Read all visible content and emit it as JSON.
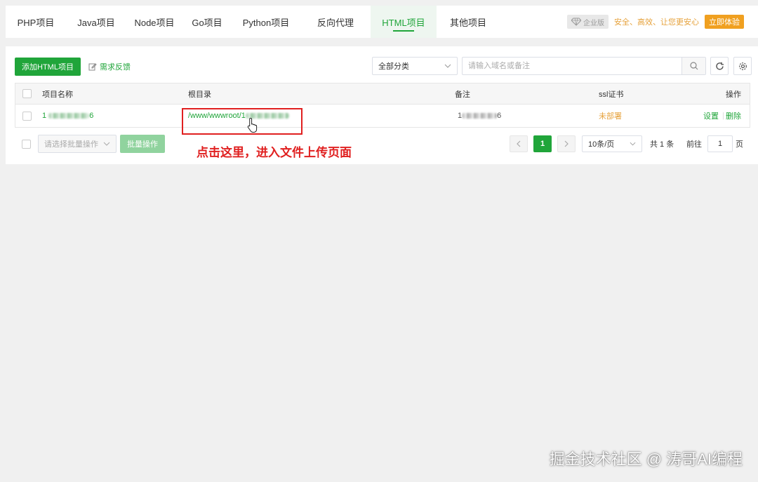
{
  "tabs": [
    {
      "label": "PHP项目"
    },
    {
      "label": "Java项目"
    },
    {
      "label": "Node项目"
    },
    {
      "label": "Go项目"
    },
    {
      "label": "Python项目"
    },
    {
      "label": "反向代理"
    },
    {
      "label": "HTML项目"
    },
    {
      "label": "其他项目"
    }
  ],
  "active_tab": "HTML项目",
  "enterprise": {
    "badge": "企业版",
    "slogan": "安全、高效、让您更安心",
    "trial_button": "立即体验"
  },
  "toolbar": {
    "add_button": "添加HTML项目",
    "feedback_link": "需求反馈",
    "category_select": "全部分类",
    "search_placeholder": "请输入域名或备注"
  },
  "table": {
    "columns": {
      "name": "项目名称",
      "root": "根目录",
      "remark": "备注",
      "ssl": "ssl证书",
      "ops": "操作"
    },
    "rows": [
      {
        "name_prefix": "1",
        "name_suffix": "6",
        "root_prefix": "/www/wwwroot/1",
        "remark_prefix": "1",
        "remark_suffix": "6",
        "ssl": "未部署",
        "action_settings": "设置",
        "action_delete": "删除"
      }
    ]
  },
  "annotation": "点击这里，进入文件上传页面",
  "footer": {
    "batch_select_placeholder": "请选择批量操作",
    "batch_button": "批量操作",
    "current_page": "1",
    "page_size": "10条/页",
    "total": "共 1 条",
    "goto_label": "前往",
    "goto_value": "1",
    "page_unit": "页"
  },
  "watermark": "掘金技术社区 @ 涛哥AI编程",
  "colors": {
    "accent": "#20a53a",
    "warning": "#e6a23c",
    "annotation": "#e02020"
  }
}
